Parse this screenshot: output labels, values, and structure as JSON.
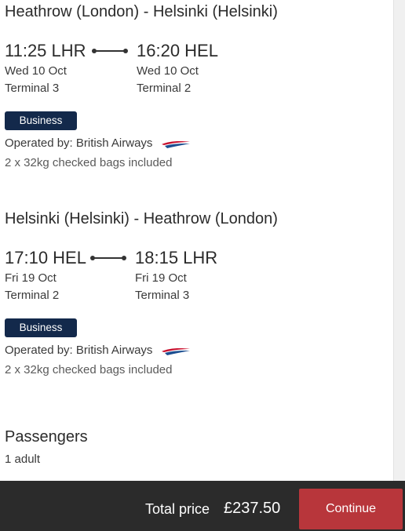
{
  "flights": [
    {
      "route": "Heathrow (London) - Helsinki (Helsinki)",
      "depart": {
        "time": "11:25 LHR",
        "date": "Wed 10 Oct",
        "terminal": "Terminal 3"
      },
      "arrive": {
        "time": "16:20 HEL",
        "date": "Wed 10 Oct",
        "terminal": "Terminal 2"
      },
      "cabin": "Business",
      "operated_by": "Operated by: British Airways",
      "bags": "2 x 32kg checked bags included"
    },
    {
      "route": "Helsinki (Helsinki) - Heathrow (London)",
      "depart": {
        "time": "17:10 HEL",
        "date": "Fri 19 Oct",
        "terminal": "Terminal 2"
      },
      "arrive": {
        "time": "18:15 LHR",
        "date": "Fri 19 Oct",
        "terminal": "Terminal 3"
      },
      "cabin": "Business",
      "operated_by": "Operated by: British Airways",
      "bags": "2 x 32kg checked bags included"
    }
  ],
  "passengers": {
    "title": "Passengers",
    "count": "1 adult"
  },
  "footer": {
    "total_label": "Total price",
    "total_value": "£237.50",
    "continue_label": "Continue"
  },
  "colors": {
    "badge": "#13294b",
    "continue": "#b8363b",
    "footer": "#2b2b2b",
    "ba_red": "#c8102e",
    "ba_blue": "#1d4f91"
  },
  "icons": {
    "airline_logo": "british-airways-speedmarque-icon"
  }
}
